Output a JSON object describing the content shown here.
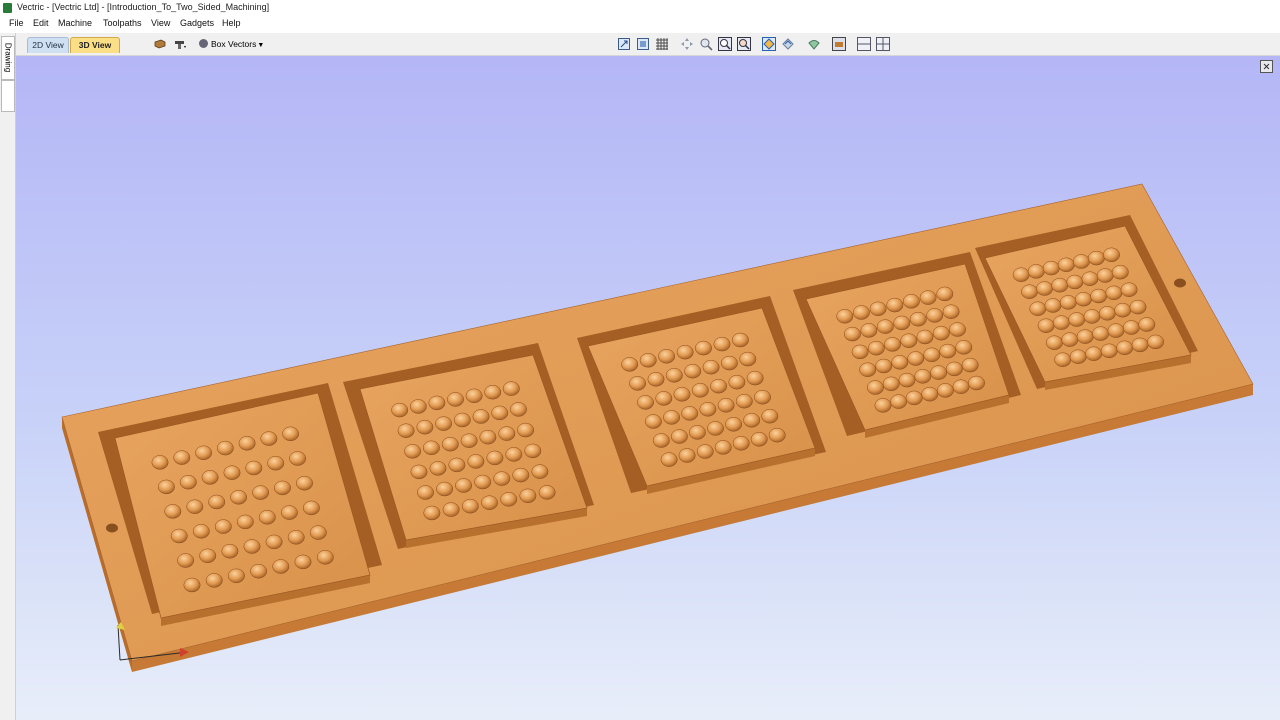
{
  "window": {
    "title": "Vectric - [Vectric Ltd] - [Introduction_To_Two_Sided_Machining]"
  },
  "menu": [
    "File",
    "Edit",
    "Machine",
    "Toolpaths",
    "View",
    "Gadgets",
    "Help"
  ],
  "view_tabs": {
    "tab_2d": "2D View",
    "tab_3d": "3D View",
    "active": "3D View"
  },
  "toolbar": {
    "box_vectors_label": "Box Vectors"
  },
  "side_panel": {
    "drawing_tab": "Drawing"
  },
  "toolbar_icons": [
    "material-icon",
    "tool-icon",
    "view-top-icon",
    "view-iso-icon",
    "grid-icon",
    "pan-icon",
    "zoom-icon",
    "zoom-fit-icon",
    "zoom-window-icon",
    "rotate-icon",
    "shade-icon",
    "lighting-icon",
    "material-display-icon",
    "toolpath-preview-icon",
    "split-view-icon"
  ],
  "scene": {
    "description_visible": false,
    "part_color": "#e09a55",
    "pocket_count": 5,
    "dome_grid": "7x6"
  }
}
